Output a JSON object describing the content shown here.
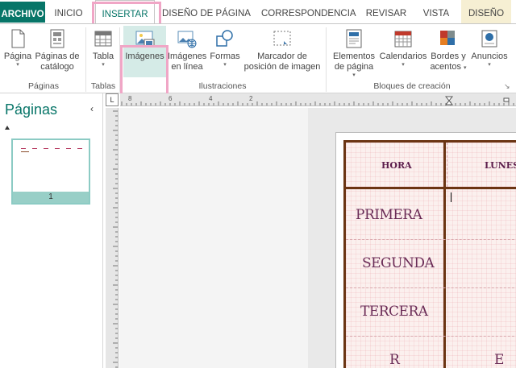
{
  "tabs": [
    {
      "label": "ARCHIVO"
    },
    {
      "label": "INICIO"
    },
    {
      "label": "INSERTAR"
    },
    {
      "label": "DISEÑO DE PÁGINA"
    },
    {
      "label": "CORRESPONDENCIA"
    },
    {
      "label": "REVISAR"
    },
    {
      "label": "VISTA"
    },
    {
      "label": "DISEÑO"
    }
  ],
  "ribbon": {
    "groups": {
      "paginas": "Páginas",
      "tablas": "Tablas",
      "ilustraciones": "Ilustraciones",
      "bloques": "Bloques de creación"
    },
    "buttons": {
      "pagina": "Página",
      "paginas_catalogo_1": "Páginas de",
      "paginas_catalogo_2": "catálogo",
      "tabla": "Tabla",
      "imagenes": "Imágenes",
      "imagenes_linea_1": "Imágenes",
      "imagenes_linea_2": "en línea",
      "formas": "Formas",
      "marcador_1": "Marcador de",
      "marcador_2": "posición de imagen",
      "elementos_1": "Elementos",
      "elementos_2": "de página",
      "calendarios": "Calendarios",
      "bordes_1": "Bordes y",
      "bordes_2": "acentos",
      "anuncios": "Anuncios"
    }
  },
  "pages_pane": {
    "title": "Páginas",
    "collapse": "‹",
    "thumb_number": "1"
  },
  "ruler": {
    "corner": "L",
    "h_labels": [
      "8",
      "6",
      "4",
      "2"
    ]
  },
  "schedule": {
    "header_hora": "HORA",
    "header_lunes": "LUNES",
    "rows": [
      "PRIMERA",
      "SEGUNDA",
      "TERCERA",
      "R"
    ],
    "extra_cell": "E"
  },
  "colors": {
    "accent": "#077568",
    "highlight": "#f0a6c6",
    "table_border": "#6b3513",
    "schedule_text": "#6a2b56"
  }
}
